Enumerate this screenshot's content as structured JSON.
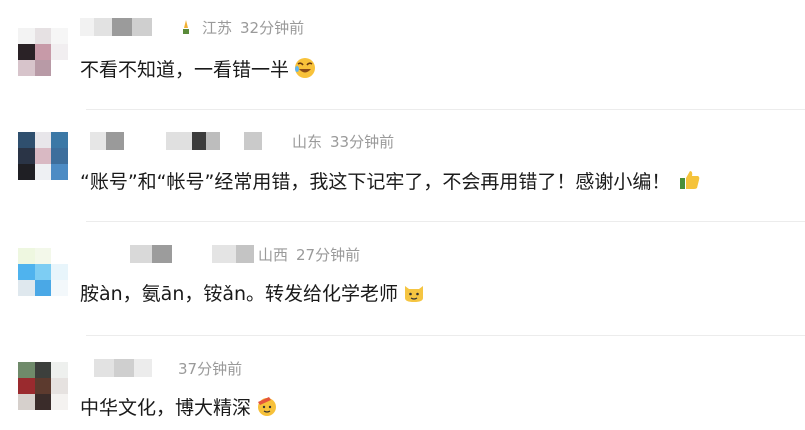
{
  "comments": [
    {
      "location": "江苏",
      "time": "32分钟前",
      "text": "不看不知道，一看错一半",
      "emoji": "laughing-crying-emoji"
    },
    {
      "location": "山东",
      "time": "33分钟前",
      "text": "“账号”和“帐号”经常用错，我这下记牢了，不会再用错了！感谢小编！",
      "emoji": "thumbs-up-emoji"
    },
    {
      "location": "山西",
      "time": "27分钟前",
      "text": "胺àn，氨ān，铵ǎn。转发给化学老师",
      "emoji": "cat-face-emoji"
    },
    {
      "location": "",
      "time": "37分钟前",
      "text": "中华文化，博大精深",
      "emoji": "salute-emoji"
    }
  ],
  "colors": {
    "meta_gray": "#9a9a9a",
    "text": "#1a1a1a",
    "divider": "#ececec"
  }
}
